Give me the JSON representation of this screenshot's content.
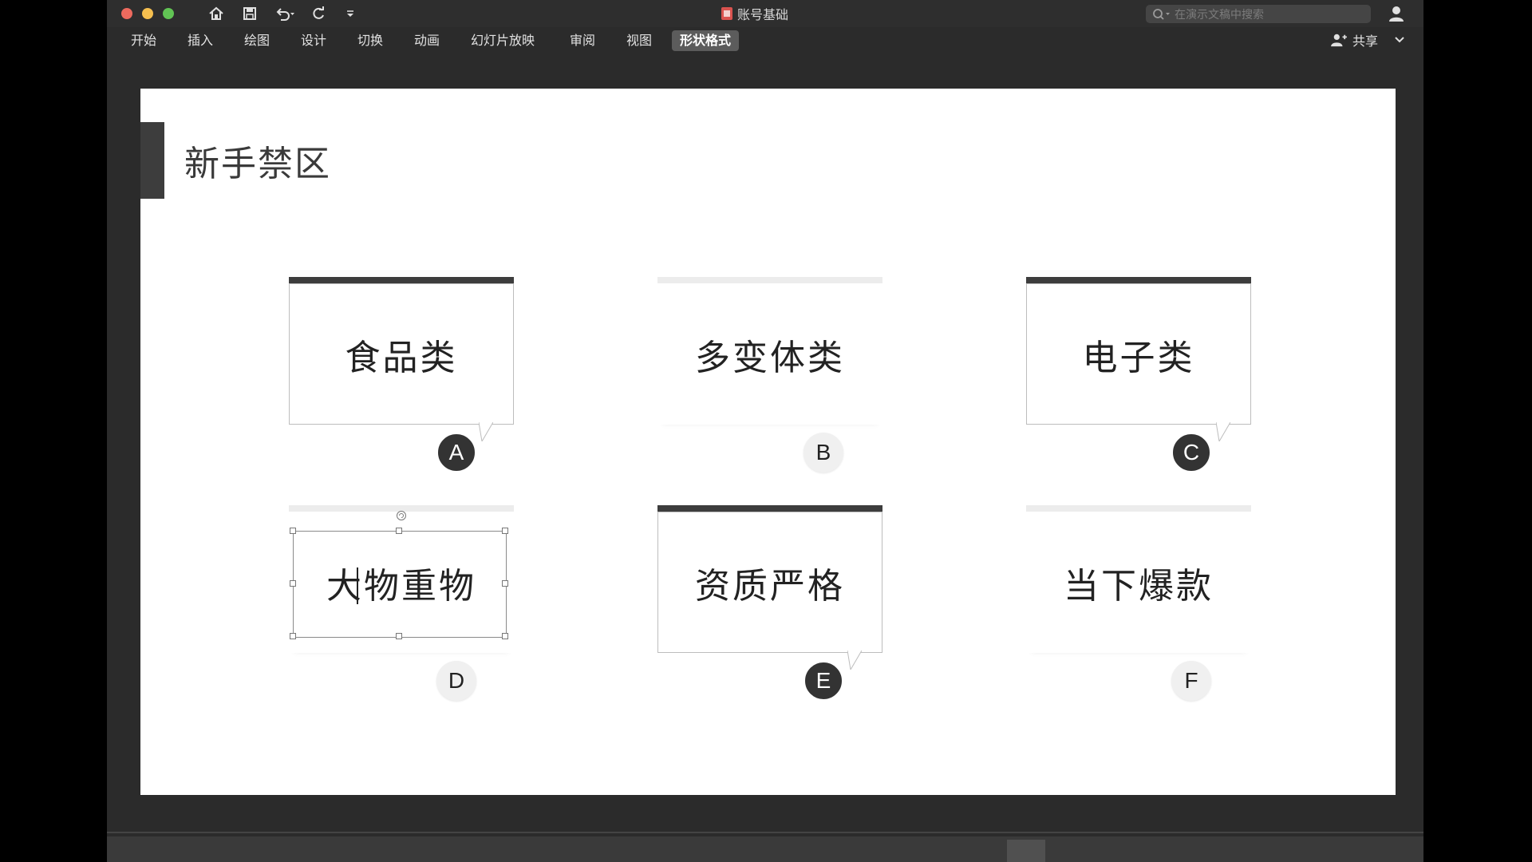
{
  "window": {
    "doc_title": "账号基础",
    "search_placeholder": "在演示文稿中搜索",
    "share_label": "共享"
  },
  "ribbon": {
    "tabs": [
      "开始",
      "插入",
      "绘图",
      "设计",
      "切换",
      "动画",
      "幻灯片放映",
      "审阅",
      "视图",
      "形状格式"
    ],
    "active_tab": "形状格式"
  },
  "slide": {
    "title": "新手禁区",
    "cards": [
      {
        "label": "食品类",
        "badge": "A",
        "style": "dark"
      },
      {
        "label": "多变体类",
        "badge": "B",
        "style": "light"
      },
      {
        "label": "电子类",
        "badge": "C",
        "style": "dark"
      },
      {
        "label": "大物重物",
        "badge": "D",
        "style": "light",
        "selected": true
      },
      {
        "label": "资质严格",
        "badge": "E",
        "style": "dark"
      },
      {
        "label": "当下爆款",
        "badge": "F",
        "style": "light"
      }
    ]
  },
  "colors": {
    "accent_dark": "#3d3d3d",
    "badge_light": "#f0f0f0",
    "window_bg": "#2b2b2b"
  }
}
